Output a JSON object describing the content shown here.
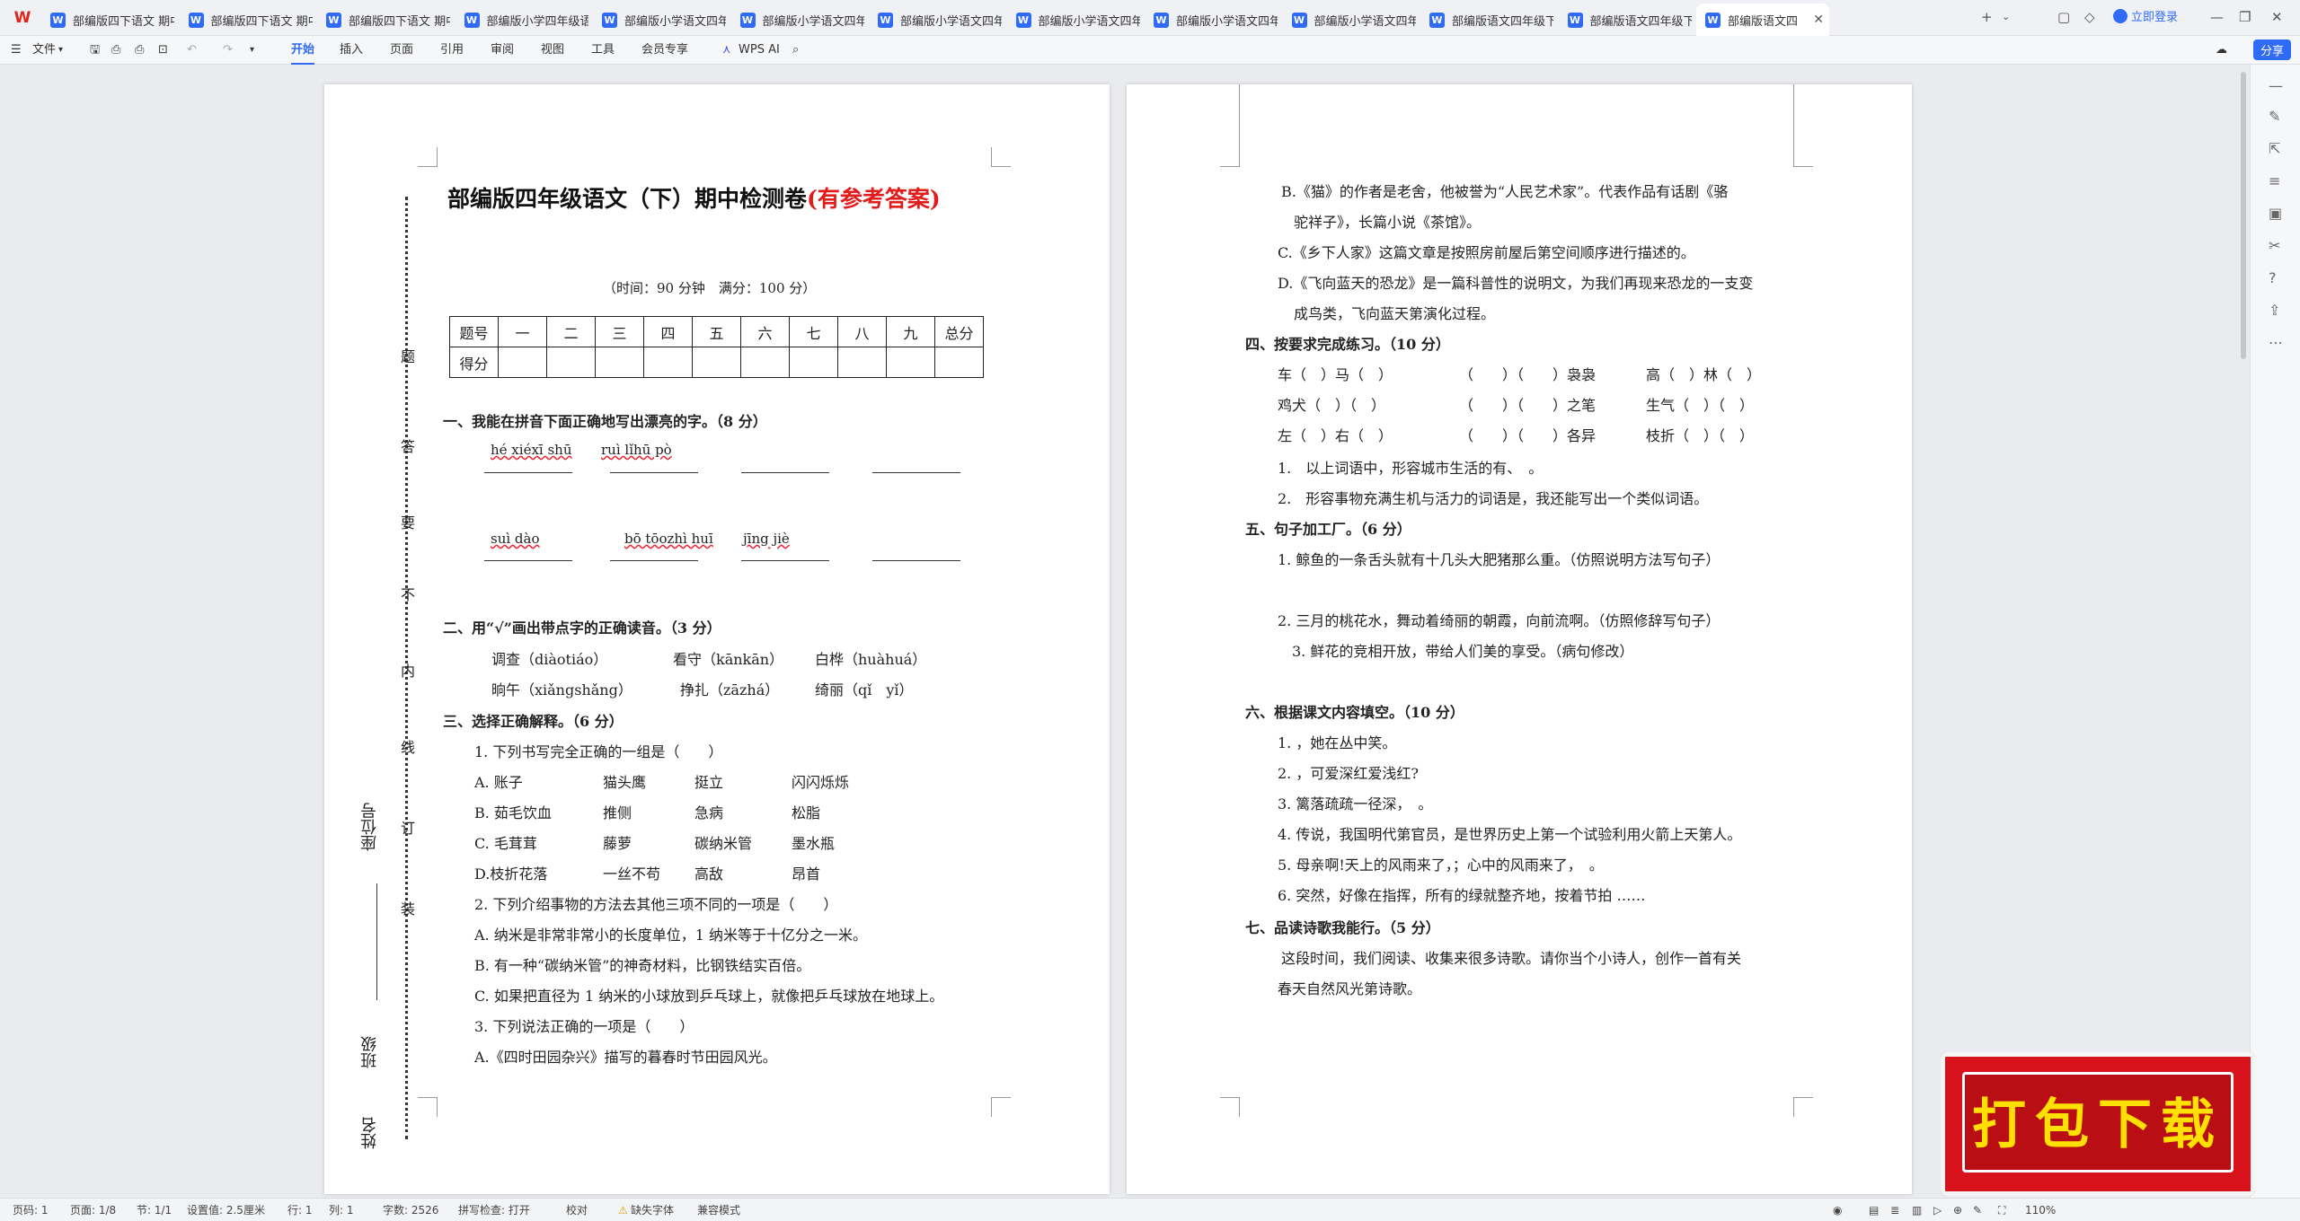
{
  "tabs": [
    {
      "label": "部编版四下语文 期中"
    },
    {
      "label": "部编版四下语文 期中"
    },
    {
      "label": "部编版四下语文 期中"
    },
    {
      "label": "部编版小学四年级语"
    },
    {
      "label": "部编版小学语文四年"
    },
    {
      "label": "部编版小学语文四年"
    },
    {
      "label": "部编版小学语文四年"
    },
    {
      "label": "部编版小学语文四年"
    },
    {
      "label": "部编版小学语文四年"
    },
    {
      "label": "部编版小学语文四年"
    },
    {
      "label": "部编版语文四年级下"
    },
    {
      "label": "部编版语文四年级下"
    },
    {
      "label": "部编版语文四"
    }
  ],
  "login": "立即登录",
  "toolbar": {
    "file": "文件",
    "menus": [
      "开始",
      "插入",
      "页面",
      "引用",
      "审阅",
      "视图",
      "工具",
      "会员专享"
    ],
    "ai": "WPS AI",
    "share": "分享"
  },
  "doc": {
    "title_main": "部编版四年级语文（下）期中检测卷",
    "title_red": "(有参考答案)",
    "time": "（时间：90 分钟　满分：100 分）",
    "score_header": [
      "题号",
      "一",
      "二",
      "三",
      "四",
      "五",
      "六",
      "七",
      "八",
      "九",
      "总分"
    ],
    "score_row_label": "得分",
    "binding_chars": [
      "题",
      "答",
      "要",
      "不",
      "内",
      "线",
      "订",
      "装"
    ],
    "seat_label": "座位号",
    "class_label": "班级",
    "name_label": "姓名",
    "q1": "一、我能在拼音下面正确地写出漂亮的字。（8 分）",
    "py1": [
      "hé xiéxī shū",
      "ruì lǐhū pò"
    ],
    "py2": [
      "suì dào",
      "bō tōozhì huī",
      "jīng jiè"
    ],
    "q2": "二、用“√”画出带点字的正确读音。（3 分）",
    "q2_line1": [
      "调查（diàotiáo）",
      "看守（kānkān）",
      "白桦（huàhuá）"
    ],
    "q2_line2": [
      "晌午（xiǎngshǎng）",
      "挣扎（zāzhá）",
      "绮丽（qǐ　yǐ）"
    ],
    "q3": "三、选择正确解释。（6 分）",
    "q3_1": "1. 下列书写完全正确的一组是（　　）",
    "q3_1_opts": [
      [
        "A. 账子",
        "猫头鹰",
        "挺立",
        "闪闪烁烁"
      ],
      [
        "B. 茹毛饮血",
        "推侧",
        "急病",
        "松脂"
      ],
      [
        "C. 毛茸茸",
        "藤萝",
        "碳纳米管",
        "墨水瓶"
      ],
      [
        "D.枝折花落",
        "一丝不苟",
        "高敌",
        "昂首"
      ]
    ],
    "q3_2": "2. 下列介绍事物的方法去其他三项不同的一项是（　　）",
    "q3_2_a": "A. 纳米是非常非常小的长度单位，1 纳米等于十亿分之一米。",
    "q3_2_b": "B. 有一种“碳纳米管”的神奇材料，比钢铁结实百倍。",
    "q3_2_c": "C. 如果把直径为 1 纳米的小球放到乒乓球上，就像把乒乓球放在地球上。",
    "q3_3": "3. 下列说法正确的一项是（　　）",
    "q3_3_a": "A.《四时田园杂兴》描写的暮春时节田园风光。",
    "p2_b1": "B.《猫》的作者是老舍，他被誉为“人民艺术家”。代表作品有话剧《骆",
    "p2_b2": "驼祥子》，长篇小说《茶馆》。",
    "p2_c": "C.《乡下人家》这篇文章是按照房前屋后第空间顺序进行描述的。",
    "p2_d1": "D.《飞向蓝天的恐龙》是一篇科普性的说明文，为我们再现来恐龙的一支变",
    "p2_d2": "成鸟类，飞向蓝天第演化过程。",
    "q4": "四、按要求完成练习。（10 分）",
    "q4_rows": [
      [
        "车（　）马（　）",
        "（　　）（　　）袅袅",
        "高（　）林（　）"
      ],
      [
        "鸡犬（　）（　）",
        "（　　）（　　）之笔",
        "生气（　）（　）"
      ],
      [
        "左（　）右（　）",
        "（　　）（　　）各异",
        "枝折（　）（　）"
      ]
    ],
    "q4_1": "1.　以上词语中，形容城市生活的有、　。",
    "q4_2": "2.　形容事物充满生机与活力的词语是，我还能写出一个类似词语。",
    "q5": "五、句子加工厂。（6 分）",
    "q5_1": "1. 鲸鱼的一条舌头就有十几头大肥猪那么重。（仿照说明方法写句子）",
    "q5_2": "2. 三月的桃花水，舞动着绮丽的朝霞，向前流啊。（仿照修辞写句子）",
    "q5_3": "3. 鲜花的竞相开放，带给人们美的享受。（病句修改）",
    "q6": "六、根据课文内容填空。（10 分）",
    "q6_items": [
      "1. ，她在丛中笑。",
      "2. ，可爱深红爱浅红?",
      "3. 篱落疏疏一径深，　。",
      "4. 传说，我国明代第官员，是世界历史上第一个试验利用火箭上天第人。",
      "5. 母亲啊!天上的风雨来了，；心中的风雨来了，　。",
      "6. 突然，好像在指挥，所有的绿就整齐地，按着节拍 ……"
    ],
    "q7": "七、品读诗歌我能行。（5 分）",
    "q7_1": "这段时间，我们阅读、收集来很多诗歌。请你当个小诗人，创作一首有关",
    "q7_2": "春天自然风光第诗歌。"
  },
  "promo": "打包下载",
  "status": {
    "page": "页码: 1",
    "pages": "页面: 1/8",
    "section": "节: 1/1",
    "setting": "设置值: 2.5厘米",
    "row": "行: 1",
    "col": "列: 1",
    "words": "字数: 2526",
    "spell": "拼写检查: 打开",
    "proof": "校对",
    "missing_font": "缺失字体",
    "compat": "兼容模式",
    "zoom": "110%"
  }
}
